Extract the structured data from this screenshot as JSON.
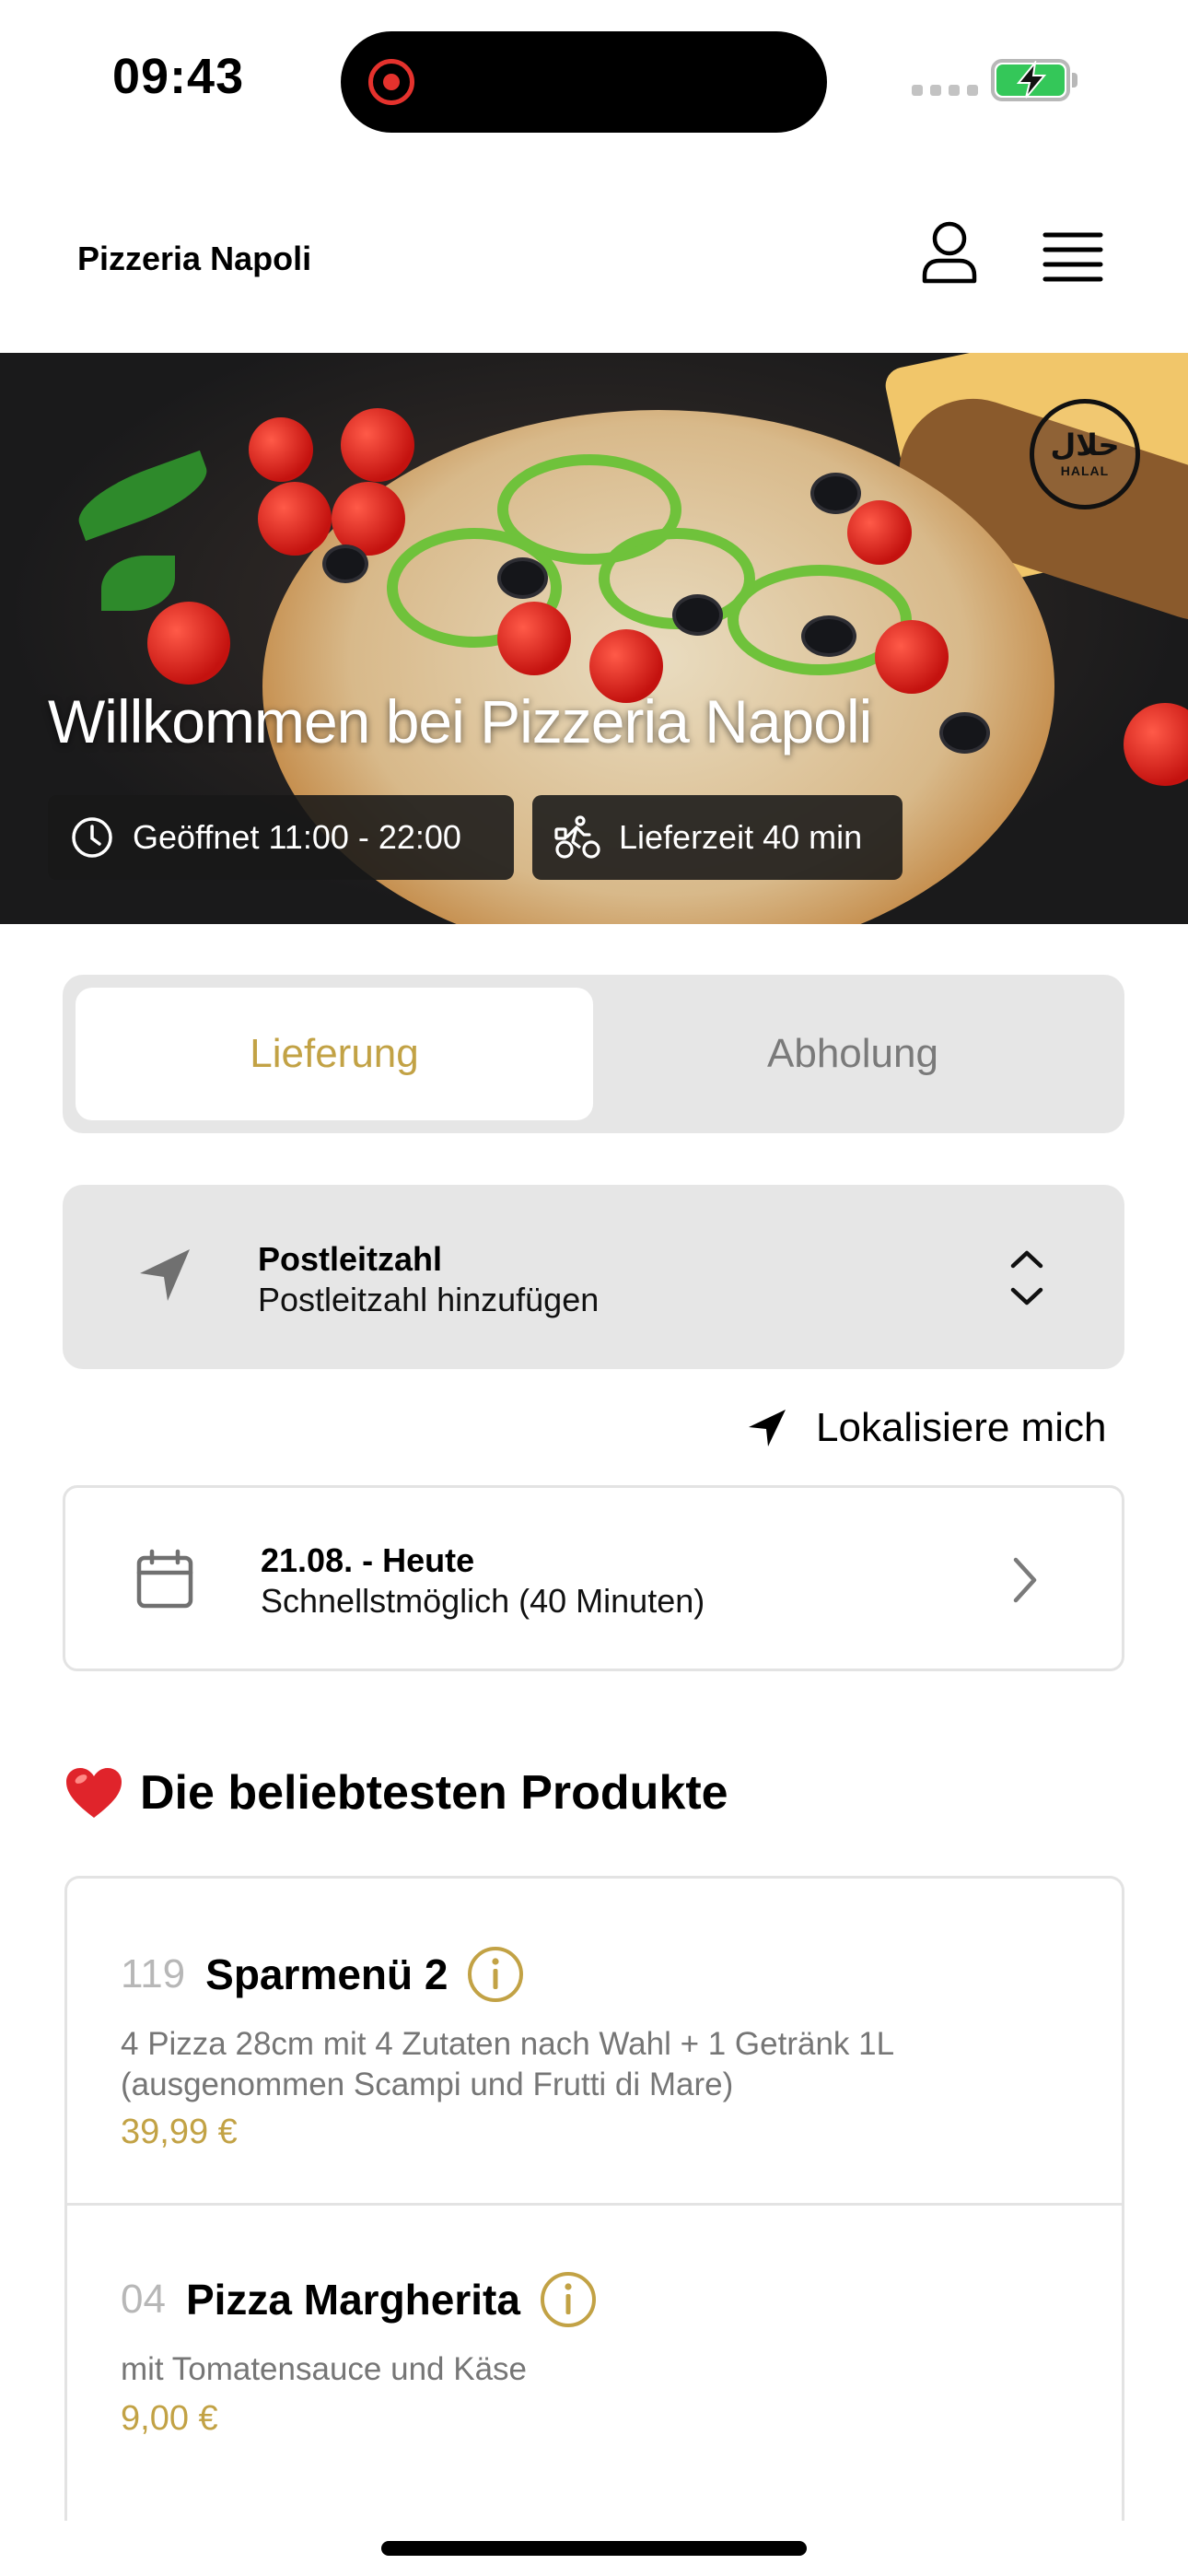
{
  "status_bar": {
    "time": "09:43"
  },
  "header": {
    "brand": "Pizzeria Napoli",
    "icons": [
      "user-icon",
      "hamburger-menu-icon"
    ]
  },
  "hero": {
    "title": "Willkommen bei Pizzeria Napoli",
    "badge_arabic": "حلال",
    "badge_text": "HALAL",
    "opening_hours": "Geöffnet 11:00 - 22:00",
    "delivery_time": "Lieferzeit 40 min"
  },
  "mode_toggle": {
    "options": [
      "Lieferung",
      "Abholung"
    ],
    "selected": "Lieferung",
    "active_color": "#C2A245"
  },
  "postcode": {
    "label": "Postleitzahl",
    "placeholder": "Postleitzahl hinzufügen"
  },
  "locate": {
    "label": "Lokalisiere mich"
  },
  "delivery_date": {
    "title": "21.08. - Heute",
    "subtitle": "Schnellstmöglich (40 Minuten)"
  },
  "popular": {
    "title": "Die beliebtesten Produkte",
    "products": [
      {
        "number": "119",
        "name": "Sparmenü 2",
        "description": "4 Pizza 28cm mit 4 Zutaten nach Wahl + 1 Getränk 1L (ausgenommen Scampi und Frutti di Mare)",
        "price": "39,99 €"
      },
      {
        "number": "04",
        "name": "Pizza Margherita",
        "description": "mit Tomatensauce und Käse",
        "price": "9,00 €"
      }
    ]
  }
}
